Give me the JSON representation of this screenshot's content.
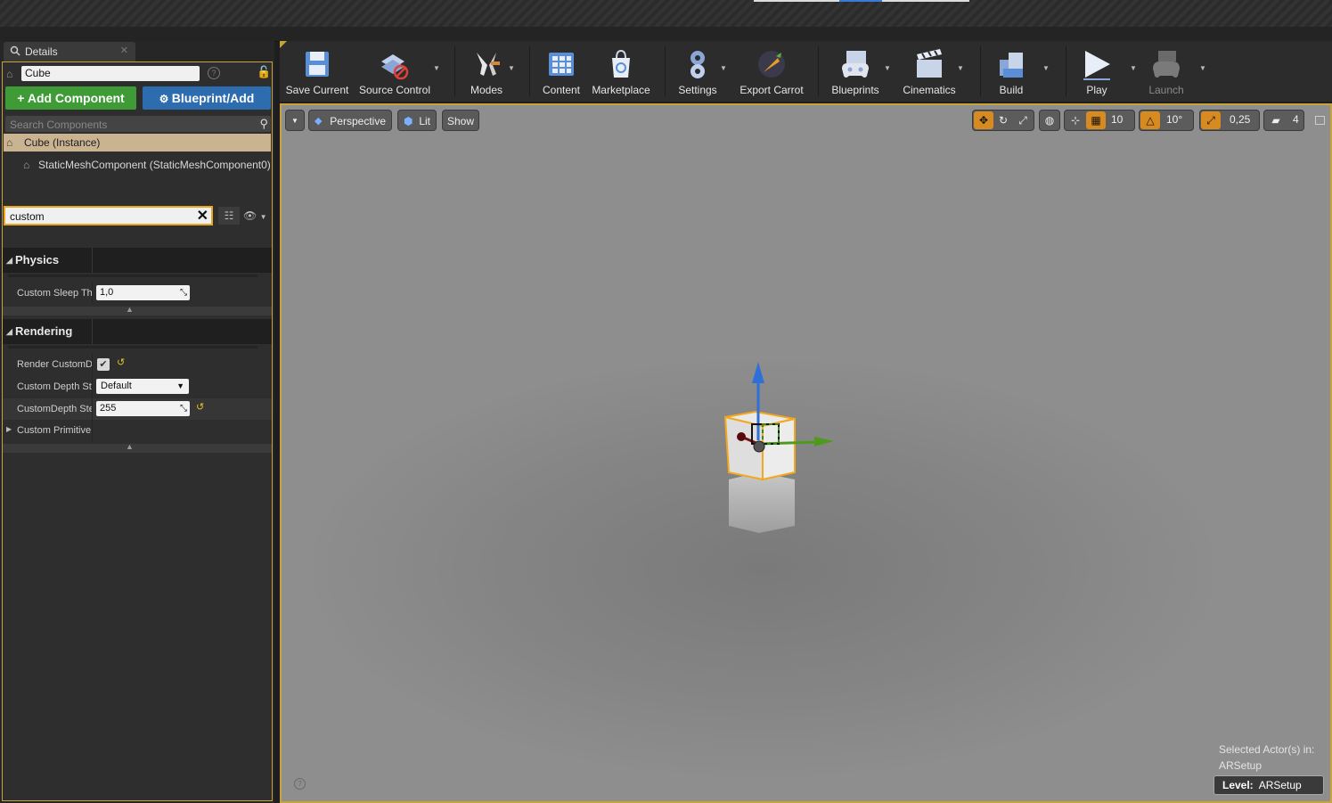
{
  "colors": {
    "accent": "#c8a23a",
    "add_green": "#3e9b36",
    "blueprint_blue": "#2d6cae",
    "selection_orange": "#e8a51d"
  },
  "details": {
    "tab_label": "Details",
    "actor_name": "Cube",
    "add_component_label": "+ Add Component",
    "blueprint_label": "Blueprint/Add",
    "search_placeholder": "Search Components",
    "instance_label": "Cube (Instance)",
    "component_label": "StaticMeshComponent (StaticMeshComponent0)",
    "filter_value": "custom",
    "physics": {
      "label": "Physics",
      "rows": [
        {
          "label": "Custom Sleep Threshold",
          "value": "1,0"
        }
      ]
    },
    "rendering": {
      "label": "Rendering",
      "render_custom_depth_label": "Render CustomDepth Pass",
      "render_custom_depth_checked": true,
      "custom_depth_mode_label": "Custom Depth Stencil Write Mask",
      "custom_depth_mode_value": "Default",
      "custom_depth_value_label": "CustomDepth Stencil Value",
      "custom_depth_value": "255",
      "custom_primitive_label": "Custom Primitive Data"
    }
  },
  "toolbar": {
    "items": [
      {
        "label": "Save Current",
        "icon": "save-icon"
      },
      {
        "label": "Source Control",
        "icon": "source-control-icon"
      },
      {
        "label": "Modes",
        "icon": "modes-icon"
      },
      {
        "label": "Content",
        "icon": "content-icon"
      },
      {
        "label": "Marketplace",
        "icon": "marketplace-icon"
      },
      {
        "label": "Settings",
        "icon": "settings-icon"
      },
      {
        "label": "Export Carrot",
        "icon": "export-carrot-icon"
      },
      {
        "label": "Blueprints",
        "icon": "blueprints-icon"
      },
      {
        "label": "Cinematics",
        "icon": "cinematics-icon"
      },
      {
        "label": "Build",
        "icon": "build-icon"
      },
      {
        "label": "Play",
        "icon": "play-icon"
      },
      {
        "label": "Launch",
        "icon": "launch-icon",
        "disabled": true
      }
    ]
  },
  "viewport": {
    "perspective_label": "Perspective",
    "lit_label": "Lit",
    "show_label": "Show",
    "grid_snap": "10",
    "rotation_snap": "10°",
    "scale_snap": "0,25",
    "camera_speed": "4",
    "selected_line1": "Selected Actor(s) in:",
    "selected_line2": "ARSetup",
    "level_label": "Level:",
    "level_name": "ARSetup"
  }
}
